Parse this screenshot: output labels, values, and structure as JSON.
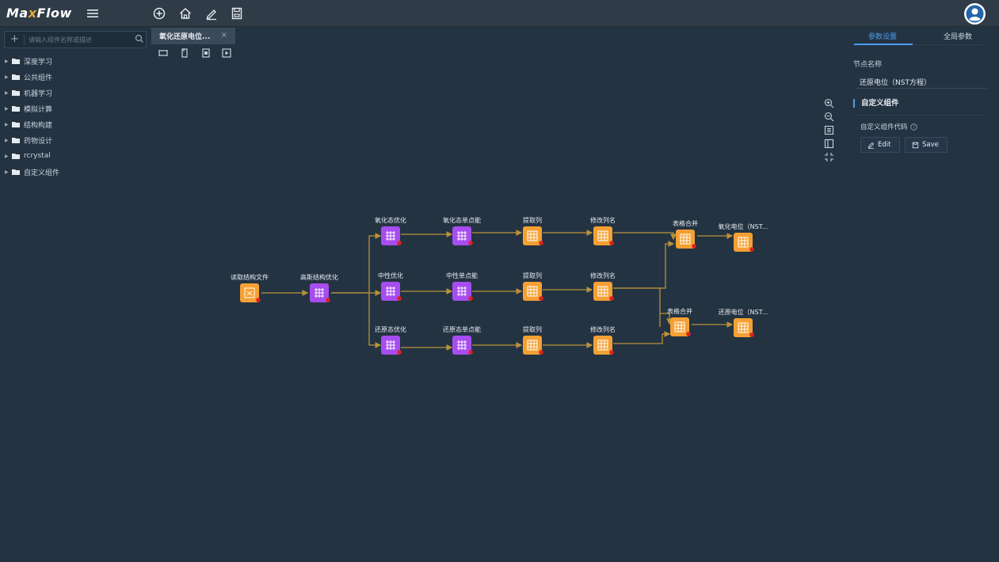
{
  "app": {
    "logo": {
      "part1": "Ma",
      "x": "x",
      "part2": "Flow"
    }
  },
  "toolbar": {
    "icons": [
      "menu-icon",
      "add-circle-icon",
      "home-icon",
      "edit-icon",
      "save-file-icon"
    ]
  },
  "sidebar": {
    "search_placeholder": "请输入组件名称或描述",
    "items": [
      {
        "label": "深度学习"
      },
      {
        "label": "公共组件"
      },
      {
        "label": "机器学习"
      },
      {
        "label": "模拟计算"
      },
      {
        "label": "结构构建"
      },
      {
        "label": "药物设计"
      },
      {
        "label": "rcrystal"
      },
      {
        "label": "自定义组件"
      }
    ]
  },
  "workspace": {
    "tab_title": "氧化还原电位...",
    "tab_close": "×"
  },
  "flow": {
    "nodes": [
      {
        "id": "n1",
        "label": "读取结构文件",
        "kind": "io"
      },
      {
        "id": "n2",
        "label": "高斯结构优化",
        "kind": "compute"
      },
      {
        "id": "n3",
        "label": "氧化态优化",
        "kind": "compute"
      },
      {
        "id": "n4",
        "label": "中性优化",
        "kind": "compute"
      },
      {
        "id": "n5",
        "label": "还原态优化",
        "kind": "compute"
      },
      {
        "id": "n6",
        "label": "氧化态单点能",
        "kind": "compute"
      },
      {
        "id": "n7",
        "label": "中性单点能",
        "kind": "compute"
      },
      {
        "id": "n8",
        "label": "还原态单点能",
        "kind": "compute"
      },
      {
        "id": "n9",
        "label": "提取列",
        "kind": "table"
      },
      {
        "id": "n10",
        "label": "提取列",
        "kind": "table"
      },
      {
        "id": "n11",
        "label": "提取列",
        "kind": "table"
      },
      {
        "id": "n12",
        "label": "修改列名",
        "kind": "table"
      },
      {
        "id": "n13",
        "label": "修改列名",
        "kind": "table"
      },
      {
        "id": "n14",
        "label": "修改列名",
        "kind": "table"
      },
      {
        "id": "n15",
        "label": "表格合并",
        "kind": "table"
      },
      {
        "id": "n16",
        "label": "表格合并",
        "kind": "table"
      },
      {
        "id": "n17",
        "label": "氧化电位（NST...",
        "kind": "output"
      },
      {
        "id": "n18",
        "label": "还原电位（NST...",
        "kind": "output"
      }
    ]
  },
  "right_panel": {
    "tabs": [
      "参数设置",
      "全局参数"
    ],
    "node_name_label": "节点名称",
    "node_name_value": "还原电位（NST方程）",
    "section_title": "自定义组件",
    "code_label": "自定义组件代码",
    "edit_label": "Edit",
    "save_label": "Save"
  },
  "colors": {
    "background": "#243342",
    "topbar": "#2f3b47",
    "accent": "#4a9eed",
    "edge": "#b9923a",
    "node_orange": "#f4a033",
    "node_purple": "#a64df0",
    "port_red": "#e0201c"
  }
}
